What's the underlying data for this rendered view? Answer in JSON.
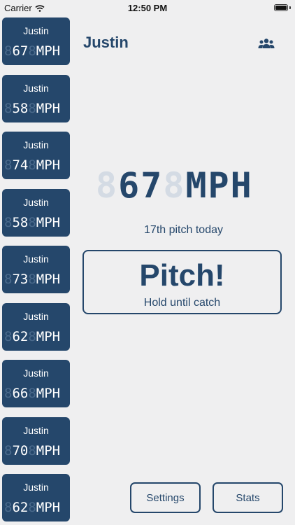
{
  "status_bar": {
    "carrier": "Carrier",
    "time": "12:50 PM"
  },
  "header": {
    "player_name": "Justin",
    "team_icon": "people-group-icon"
  },
  "history": [
    {
      "name": "Justin",
      "speed": "67",
      "unit": "MPH"
    },
    {
      "name": "Justin",
      "speed": "58",
      "unit": "MPH"
    },
    {
      "name": "Justin",
      "speed": "74",
      "unit": "MPH"
    },
    {
      "name": "Justin",
      "speed": "58",
      "unit": "MPH"
    },
    {
      "name": "Justin",
      "speed": "73",
      "unit": "MPH"
    },
    {
      "name": "Justin",
      "speed": "62",
      "unit": "MPH"
    },
    {
      "name": "Justin",
      "speed": "66",
      "unit": "MPH"
    },
    {
      "name": "Justin",
      "speed": "70",
      "unit": "MPH"
    },
    {
      "name": "Justin",
      "speed": "62",
      "unit": "MPH"
    }
  ],
  "current": {
    "speed": "67",
    "unit": "MPH",
    "pitch_count_text": "17th pitch today"
  },
  "pitch_button": {
    "label": "Pitch!",
    "sub_label": "Hold until catch"
  },
  "bottom_buttons": {
    "settings": "Settings",
    "stats": "Stats"
  },
  "colors": {
    "accent": "#25476b",
    "background": "#efeff0",
    "ghost_segment": "#d4dbe4"
  }
}
